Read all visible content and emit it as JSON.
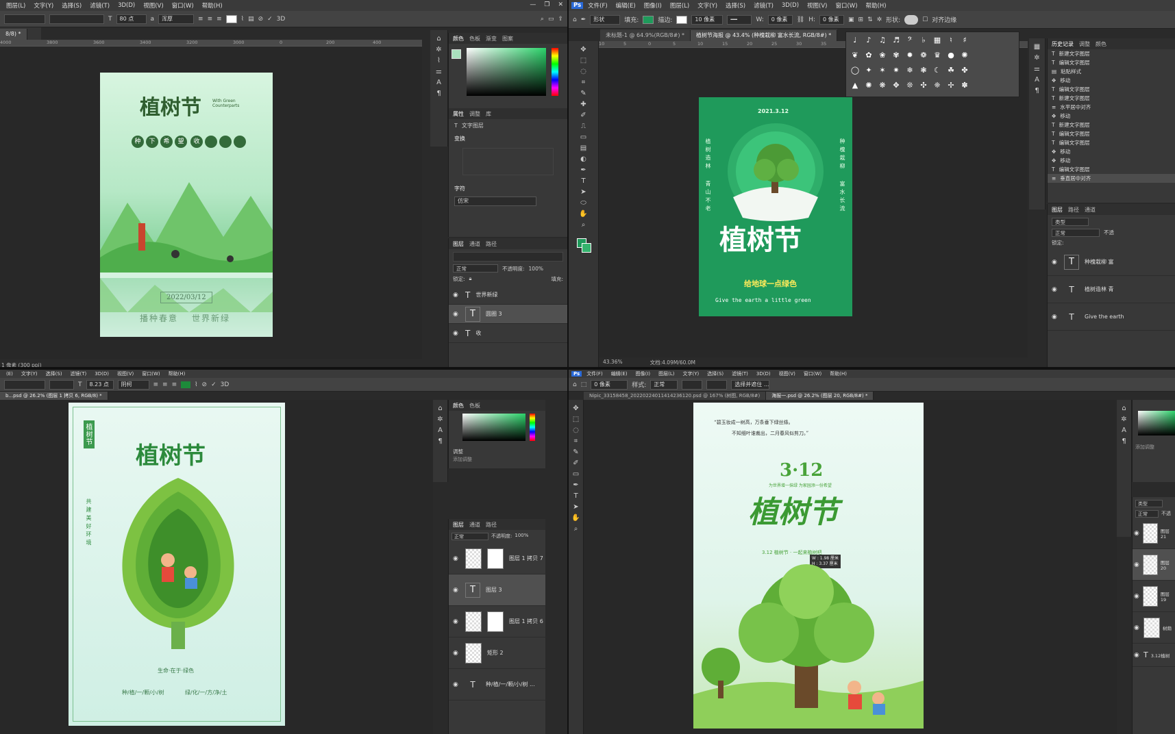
{
  "q1": {
    "menu": [
      "图层(L)",
      "文字(Y)",
      "选择(S)",
      "滤镜(T)",
      "3D(D)",
      "视图(V)",
      "窗口(W)",
      "帮助(H)"
    ],
    "font_size": "80 点",
    "aa_mode": "浑厚",
    "status_text": "1 像素 (300 ppi)",
    "ruler": [
      "4000",
      "3800",
      "3600",
      "3400",
      "3200",
      "3000",
      "0",
      "200",
      "400",
      "600",
      "800",
      "1000"
    ],
    "panel_tabs_color": [
      "颜色",
      "色板",
      "渐变",
      "图案"
    ],
    "panel_tabs_props": [
      "属性",
      "调整",
      "库"
    ],
    "props_label": "文字图层",
    "transform_label": "变换",
    "char_label": "字符",
    "font_name": "仿宋",
    "layer_tabs": [
      "图层",
      "通道",
      "路径"
    ],
    "blend_mode": "正常",
    "opacity_label": "不透明度:",
    "opacity": "100%",
    "lock_label": "锁定:",
    "fill_label": "填充:",
    "layers": [
      "世界新绿",
      "圆圈 3",
      "收"
    ],
    "poster": {
      "title": "植树节",
      "subtitle_en": "With Green Counterparts",
      "circles_a": [
        "种",
        "下",
        "希",
        "望"
      ],
      "circles_b": [
        "收",
        "",
        "",
        ""
      ],
      "date": "2022/03/12",
      "slogan_a": "播种春意",
      "slogan_b": "世界新绿"
    }
  },
  "q2": {
    "menu": [
      "文件(F)",
      "编辑(E)",
      "图像(I)",
      "图层(L)",
      "文字(Y)",
      "选择(S)",
      "滤镜(T)",
      "3D(D)",
      "视图(V)",
      "窗口(W)",
      "帮助(H)"
    ],
    "shape_mode": "形状",
    "fill_label": "填充:",
    "stroke_label": "描边:",
    "stroke_size": "10 像素",
    "w_label": "W:",
    "w_value": "0 像素",
    "h_label": "H:",
    "h_value": "0 像素",
    "shape_label": "形状:",
    "align_edges": "对齐边缘",
    "tabs": [
      "未标题-1 @ 64.9%(RGB/8#) *",
      "植树节海报 @ 43.4% (种槐栽柳 富水长流, RGB/8#) *"
    ],
    "ruler": [
      "10",
      "5",
      "0",
      "5",
      "10",
      "15",
      "20",
      "25",
      "30",
      "35",
      "40",
      "45",
      "50",
      "55",
      "60",
      "65",
      "70"
    ],
    "zoom": "43.36%",
    "doc_size": "文档:4.09M/60.0M",
    "history_tabs": [
      "历史记录",
      "调整",
      "颜色"
    ],
    "history": [
      "新建文字图层",
      "编辑文字图层",
      "粘贴样式",
      "移动",
      "编辑文字图层",
      "新建文字图层",
      "水平居中对齐",
      "移动",
      "新建文字图层",
      "编辑文字图层",
      "编辑文字图层",
      "移动",
      "移动",
      "编辑文字图层",
      "垂直居中对齐"
    ],
    "layer_tabs": [
      "图层",
      "路径",
      "通道"
    ],
    "layer_filter": "类型",
    "blend_mode": "正常",
    "opacity": "不透",
    "lock_label": "锁定:",
    "layers": [
      "种槐栽柳 富",
      "植树造林 青",
      "Give the earth"
    ],
    "poster": {
      "date": "2021.3.12",
      "left_col_a": "植树造林",
      "left_col_b": "青山不老",
      "right_col_a": "种槐栽柳",
      "right_col_b": "富水长流",
      "title": "植树节",
      "subtitle": "给地球一点绿色",
      "english": "Give the earth a little green"
    }
  },
  "q3": {
    "menu": [
      "(E)",
      "文字(Y)",
      "选择(S)",
      "滤镜(T)",
      "3D(D)",
      "视图(V)",
      "窗口(W)",
      "帮助(H)"
    ],
    "font_size": "8.23 点",
    "font_name": "阴柯",
    "tab": "b...psd @ 26.2% (图层 1 拷贝 6, RGB/8) *",
    "panel_tabs_color": [
      "颜色",
      "色板"
    ],
    "adjust_label": "调整",
    "adjust_add": "添加调整",
    "layer_tabs": [
      "图层",
      "通道",
      "路径"
    ],
    "blend_mode": "正常",
    "opacity_label": "不透明度:",
    "opacity": "100%",
    "layers": [
      "图层 1 拷贝 7",
      "图层 3",
      "图层 1 拷贝 6",
      "矩形 2",
      "种/植/一/颗/小/树 ..."
    ],
    "poster": {
      "side_tag": "植树节",
      "title": "植树节",
      "side_text": "共建美好环境",
      "caption": "生命·在于·绿色",
      "line_a": "种/植/一/颗/小/树",
      "line_b": "绿/化/一/方/净/土"
    }
  },
  "q4": {
    "menu": [
      "文件(F)",
      "编辑(E)",
      "图像(I)",
      "图层(L)",
      "文字(Y)",
      "选择(S)",
      "滤镜(T)",
      "3D(D)",
      "视图(V)",
      "窗口(W)",
      "帮助(H)"
    ],
    "feather": "0 像素",
    "style_label": "样式:",
    "style_value": "正常",
    "select_btn": "选择并遮住 ...",
    "tabs": [
      "Nipic_33158458_20220224011414236120.psd @ 167% (树图, RGB/8#)",
      "海报一.psd @ 26.2% (图层 20, RGB/8#) *"
    ],
    "adjust_add": "添加调整",
    "layer_filter": "类型",
    "blend_mode": "正常",
    "opacity": "不透",
    "layers": [
      "图层 21",
      "图层 20",
      "图层 19",
      "树荫",
      "3.12植树"
    ],
    "poster": {
      "poem_a": "“碧玉妆成一树高，万条垂下绿丝绦。",
      "poem_b": "不知细叶谁裁出，二月春风似剪刀。”",
      "date": "3·12",
      "tagline": "为世界增一抹绿 为家园添一份希望",
      "title": "植树节",
      "sub": "3.12 植树节 · 一起来植树吧",
      "tooltip_w": "W : 1.98 厘米",
      "tooltip_h": "H : 3.37 厘米"
    }
  }
}
